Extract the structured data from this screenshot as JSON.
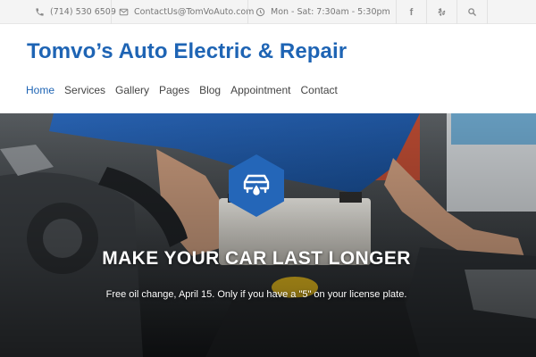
{
  "topbar": {
    "phone": "(714) 530 6509",
    "email": "ContactUs@TomVoAuto.com",
    "hours": "Mon - Sat: 7:30am - 5:30pm",
    "icons": [
      "phone-icon",
      "envelope-icon",
      "clock-icon",
      "facebook-icon",
      "yelp-icon",
      "search-icon"
    ],
    "social_facebook_glyph": "f"
  },
  "header": {
    "brand": "Tomvo’s Auto Electric & Repair"
  },
  "nav": {
    "items": [
      "Home",
      "Services",
      "Gallery",
      "Pages",
      "Blog",
      "Appointment",
      "Contact"
    ],
    "active": "Home"
  },
  "hero": {
    "title": "MAKE YOUR CAR LAST LONGER",
    "subtitle": "Free oil change, April 15. Only if you have a \"5\" on your license plate.",
    "badge_icon": "car-oil-icon"
  },
  "colors": {
    "brand_blue": "#1e64b4",
    "badge_blue": "#2466b8",
    "topbar_bg": "#f4f4f4",
    "nav_text": "#444444"
  }
}
